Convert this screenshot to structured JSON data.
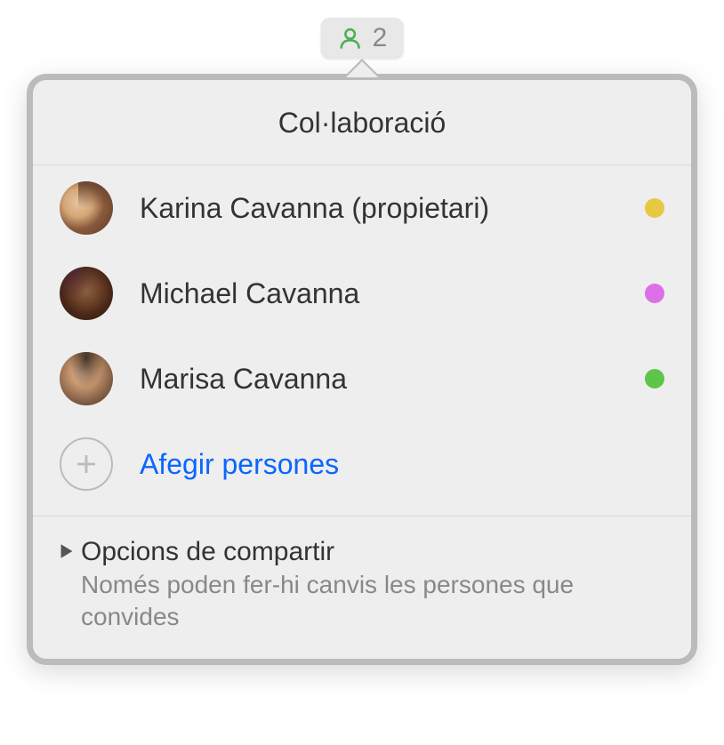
{
  "badge": {
    "count": "2",
    "icon_color": "#4caf50"
  },
  "popover": {
    "title": "Col·laboració",
    "participants": [
      {
        "name": "Karina Cavanna (propietari)",
        "status_color": "#e6c843"
      },
      {
        "name": "Michael Cavanna",
        "status_color": "#dd70e8"
      },
      {
        "name": "Marisa Cavanna",
        "status_color": "#5dc648"
      }
    ],
    "add_label": "Afegir persones",
    "footer": {
      "title": "Opcions de compartir",
      "subtitle": "Només poden fer-hi canvis les persones que convides"
    }
  }
}
